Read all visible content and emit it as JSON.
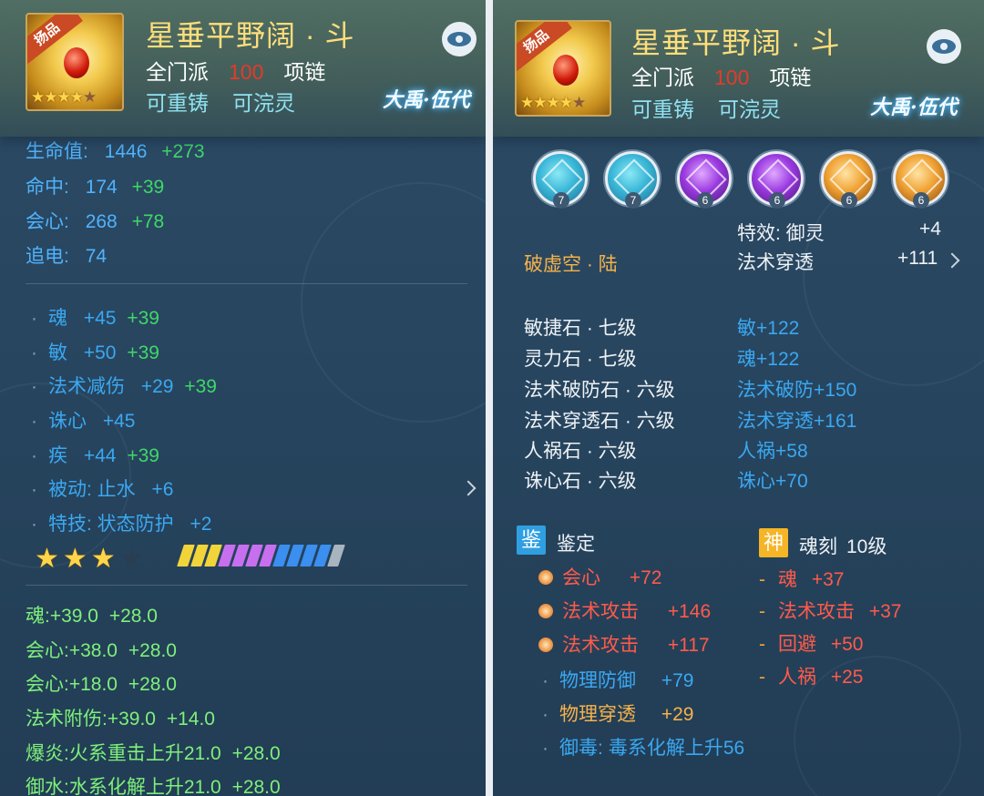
{
  "left": {
    "item": {
      "badge": "扬品",
      "name": "星垂平野阔 · 斗",
      "sect": "全门派",
      "level": "100",
      "type": "项链",
      "reforge": "可重铸",
      "soul_wash": "可浣灵",
      "server": "大禹·伍代"
    },
    "base_stats": [
      {
        "label": "生命值:",
        "value": "1446",
        "bonus": "+273"
      },
      {
        "label": "命中:",
        "value": "174",
        "bonus": "+39"
      },
      {
        "label": "会心:",
        "value": "268",
        "bonus": "+78"
      },
      {
        "label": "追电:",
        "value": "74",
        "bonus": ""
      }
    ],
    "attrs": [
      {
        "label": "魂",
        "value": "+45",
        "bonus": "+39"
      },
      {
        "label": "敏",
        "value": "+50",
        "bonus": "+39"
      },
      {
        "label": "法术减伤",
        "value": "+29",
        "bonus": "+39"
      },
      {
        "label": "诛心",
        "value": "+45",
        "bonus": ""
      },
      {
        "label": "疾",
        "value": "+44",
        "bonus": "+39"
      },
      {
        "label": "被动: 止水",
        "value": "+6",
        "bonus": ""
      },
      {
        "label": "特技: 状态防护",
        "value": "+2",
        "bonus": ""
      }
    ],
    "star_rating": {
      "filled": 3,
      "total": 4
    },
    "refine_bars": [
      "#f0d43a",
      "#f0d43a",
      "#f0d43a",
      "#c86ff0",
      "#c86ff0",
      "#c86ff0",
      "#c86ff0",
      "#3a8ff0",
      "#3a8ff0",
      "#3a8ff0",
      "#3a8ff0",
      "#a8b4c0"
    ],
    "bonus_stats": [
      {
        "label": "魂:",
        "value": "+39.0",
        "extra": "+28.0"
      },
      {
        "label": "会心:",
        "value": "+38.0",
        "extra": "+28.0"
      },
      {
        "label": "会心:",
        "value": "+18.0",
        "extra": "+28.0"
      },
      {
        "label": "法术附伤:",
        "value": "+39.0",
        "extra": "+14.0"
      },
      {
        "label": "爆炎:",
        "value": "火系重击上升21.0",
        "extra": "+28.0"
      },
      {
        "label": "御水:",
        "value": "水系化解上升21.0",
        "extra": "+28.0"
      }
    ]
  },
  "right": {
    "item": {
      "badge": "扬品",
      "name": "星垂平野阔 · 斗",
      "sect": "全门派",
      "level": "100",
      "type": "项链",
      "reforge": "可重铸",
      "soul_wash": "可浣灵",
      "server": "大禹·伍代"
    },
    "gem_slots": [
      {
        "icon": "cyan-gem-icon",
        "level": "7",
        "style": ""
      },
      {
        "icon": "cyan-gem-icon",
        "level": "7",
        "style": ""
      },
      {
        "icon": "purple-gem-icon",
        "level": "6",
        "style": "p"
      },
      {
        "icon": "purple-gem-icon",
        "level": "6",
        "style": "p"
      },
      {
        "icon": "orange-gem-icon",
        "level": "6",
        "style": "o"
      },
      {
        "icon": "orange-gem-icon",
        "level": "6",
        "style": "o"
      }
    ],
    "effect": {
      "label": "特效: 御灵",
      "value": "+4"
    },
    "set_name": "破虚空 · 陆",
    "penetration": {
      "label": "法术穿透",
      "value": "+111"
    },
    "gems": [
      {
        "name": "敏捷石 · 七级",
        "effect": "敏+122"
      },
      {
        "name": "灵力石 · 七级",
        "effect": "魂+122"
      },
      {
        "name": "法术破防石 · 六级",
        "effect": "法术破防+150"
      },
      {
        "name": "法术穿透石 · 六级",
        "effect": "法术穿透+161"
      },
      {
        "name": "人祸石 · 六级",
        "effect": "人祸+58"
      },
      {
        "name": "诛心石 · 六级",
        "effect": "诛心+70"
      }
    ],
    "appraise": {
      "badge": "鉴",
      "title": "鉴定",
      "items": [
        {
          "label": "会心",
          "value": "+72",
          "kind": "special"
        },
        {
          "label": "法术攻击",
          "value": "+146",
          "kind": "special"
        },
        {
          "label": "法术攻击",
          "value": "+117",
          "kind": "special"
        },
        {
          "label": "物理防御",
          "value": "+79",
          "kind": "normal"
        },
        {
          "label": "物理穿透",
          "value": "+29",
          "kind": "gold"
        },
        {
          "label": "御毒:",
          "value": "毒系化解上升56",
          "kind": "normal"
        }
      ]
    },
    "soul_engrave": {
      "badge": "神",
      "title": "魂刻",
      "level": "10级",
      "items": [
        {
          "label": "魂",
          "value": "+37"
        },
        {
          "label": "法术攻击",
          "value": "+37"
        },
        {
          "label": "回避",
          "value": "+50"
        },
        {
          "label": "人祸",
          "value": "+25"
        }
      ]
    }
  }
}
